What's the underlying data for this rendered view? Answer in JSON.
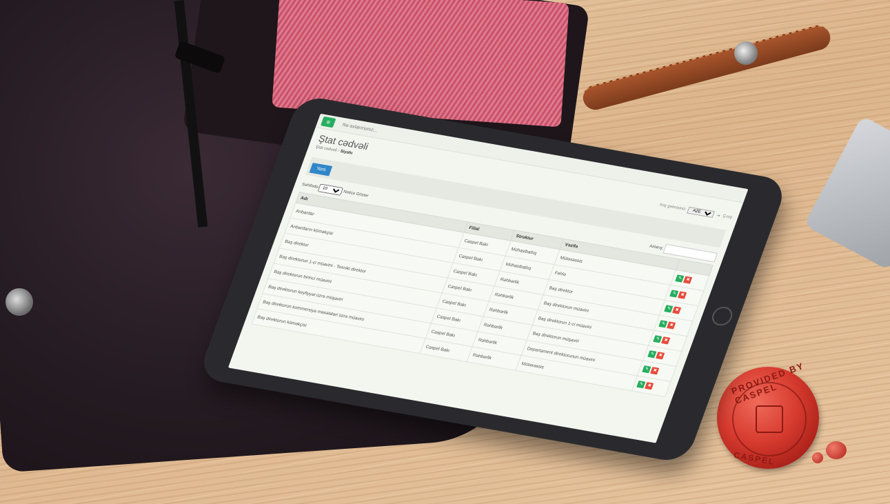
{
  "topbar": {
    "menu_icon": "≡",
    "search_placeholder": "Nə axtarırsınız..."
  },
  "header": {
    "title": "Ştat cədvəli",
    "breadcrumb": [
      "Ştat cədvəli",
      "Siyahı"
    ],
    "greeting": "Xoş gəlmisiniz",
    "language": "AZE",
    "logout_label": "Çıxış"
  },
  "toolbar": {
    "new_label": "Yeni"
  },
  "controls": {
    "per_page_prefix": "Səhifədə",
    "per_page_value": "10",
    "per_page_suffix": "Nəticə Göstər",
    "search_label": "Axtarış:"
  },
  "table": {
    "columns": [
      "Adı",
      "Filial",
      "Struktur",
      "Vəzifə"
    ],
    "rows": [
      [
        "Anbardar",
        "Caspel Bakı",
        "Mühasibatlıq",
        "Mütəxəssis"
      ],
      [
        "Anbardarın köməkçisi",
        "Caspel Bakı",
        "Mühasibatlıq",
        "Fəhlə"
      ],
      [
        "Baş direktor",
        "Caspel Bakı",
        "Rəhbərlik",
        "Baş direktor"
      ],
      [
        "Baş direktorun 1-ci müavini - Texniki direktor",
        "Caspel Bakı",
        "Rəhbərlik",
        "Baş direktorun müavini"
      ],
      [
        "Baş direktorun birinci müavini",
        "Caspel Bakı",
        "Rəhbərlik",
        "Baş direktorun 1-ci müavini"
      ],
      [
        "Baş direktorun keyfiyyət üzrə müşaviri",
        "Caspel Bakı",
        "Rəhbərlik",
        "Baş direktorun müşaviri"
      ],
      [
        "Baş direktorun kommersiya məsələləri üzrə müavini",
        "Caspel Bakı",
        "Rəhbərlik",
        "Departament direktorunun müavini"
      ],
      [
        "Baş direktorun köməkçisi",
        "Caspel Bakı",
        "Rəhbərlik",
        "Mütəxəssis"
      ]
    ]
  },
  "seal": {
    "top_text": "PROVIDED BY CASPEL",
    "bottom_text": "CASPEL"
  },
  "colors": {
    "accent_green": "#27ae60",
    "accent_blue": "#2f86c9",
    "danger_red": "#e74c3c",
    "wax": "#d63a2e"
  }
}
